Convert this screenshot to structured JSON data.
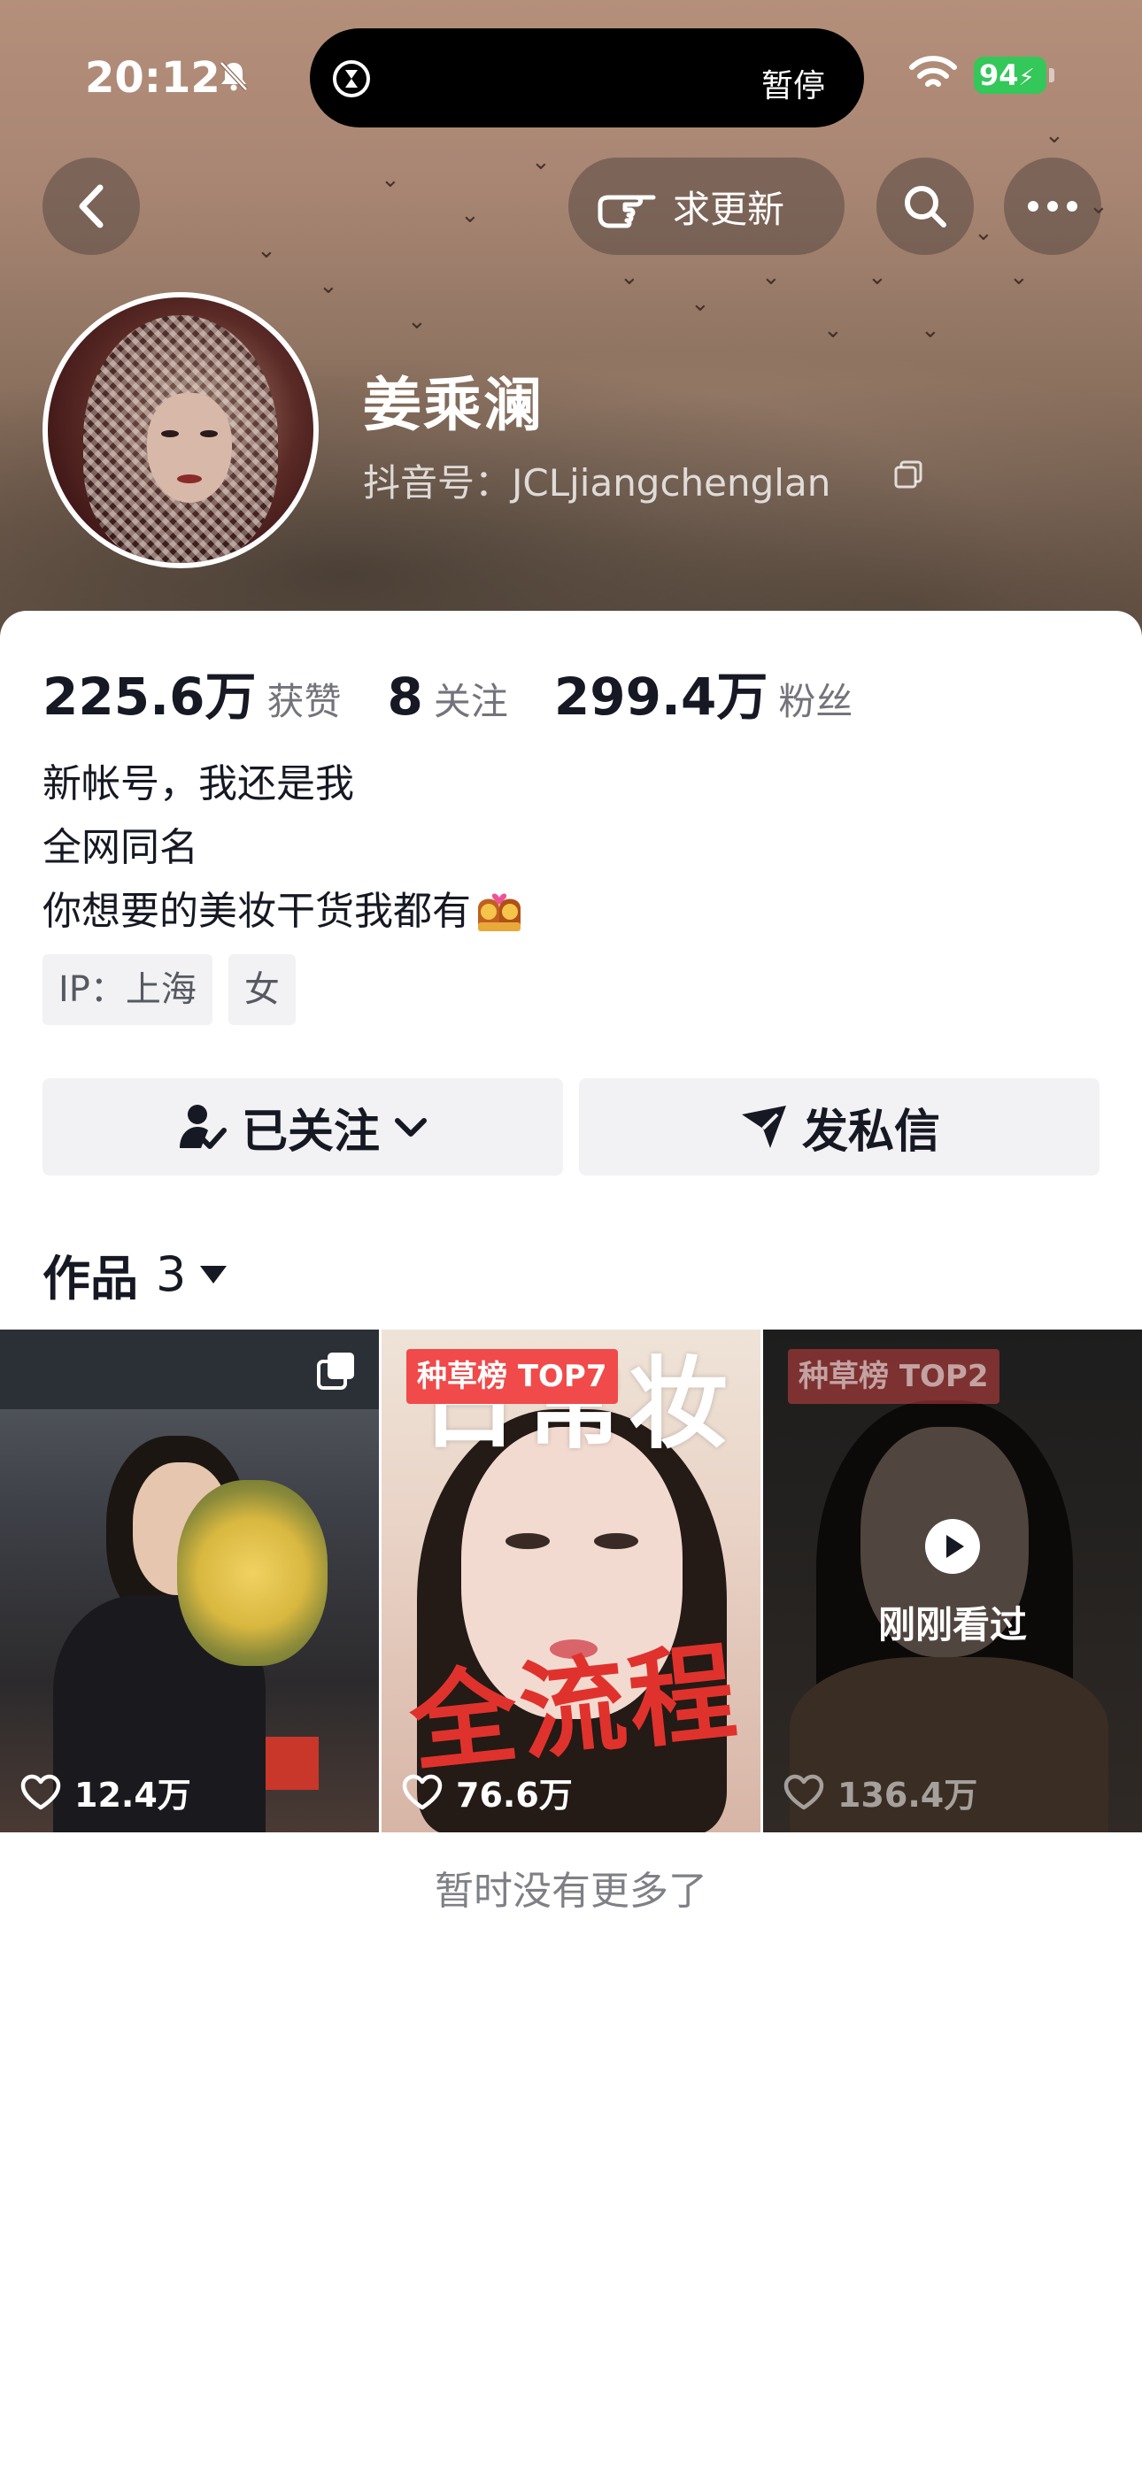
{
  "status_bar": {
    "time": "20:12",
    "island_label": "暂停",
    "battery": "94"
  },
  "header": {
    "request_update_label": "求更新",
    "icons": [
      "back-icon",
      "hand-point-icon",
      "search-icon",
      "more-icon"
    ]
  },
  "profile": {
    "name": "姜乘澜",
    "douyin_id": "抖音号：JCLjiangchenglan"
  },
  "stats": [
    {
      "value": "225.6万",
      "label": "获赞"
    },
    {
      "value": "8",
      "label": "关注"
    },
    {
      "value": "299.4万",
      "label": "粉丝"
    }
  ],
  "bio": {
    "line1": "新帐号，我还是我",
    "line2": "全网同名",
    "line3": "你想要的美妆干货我都有"
  },
  "tags": [
    {
      "label": "IP：上海"
    },
    {
      "label": "女"
    }
  ],
  "actions": {
    "follow_label": "已关注",
    "message_label": "发私信"
  },
  "works": {
    "title": "作品",
    "count": "3",
    "items": [
      {
        "likes": "12.4万",
        "badge": "",
        "overlay_title": "",
        "overlay_text": ""
      },
      {
        "likes": "76.6万",
        "badge": "种草榜 TOP7",
        "overlay_title": "日常妆",
        "overlay_text": "全流程"
      },
      {
        "likes": "136.4万",
        "badge": "种草榜 TOP2",
        "overlay_title": "",
        "overlay_text": "刚刚看过"
      }
    ]
  },
  "footer": {
    "no_more": "暂时没有更多了"
  },
  "colors": {
    "accent_red": "#f04a4a",
    "battery_green": "#34c759",
    "text_primary": "#161823",
    "button_bg": "#f2f2f4"
  }
}
